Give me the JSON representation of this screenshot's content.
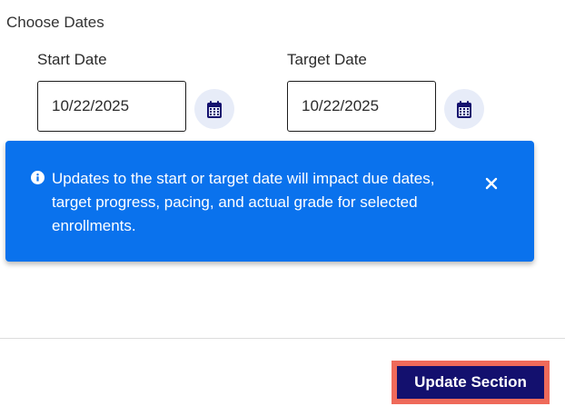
{
  "section": {
    "title": "Choose Dates"
  },
  "start_date": {
    "label": "Start Date",
    "value": "10/22/2025"
  },
  "target_date": {
    "label": "Target Date",
    "value": "10/22/2025"
  },
  "alert": {
    "message": "Updates to the start or target date will impact due dates, target progress, pacing, and actual grade for selected enrollments.",
    "background_color": "#0a72ed",
    "icon": "info-icon",
    "close_icon": "close-icon"
  },
  "footer": {
    "update_label": "Update Section",
    "button_color": "#13106e",
    "highlight_color": "#ef6a5a"
  },
  "icons": {
    "calendar": "calendar-icon"
  }
}
